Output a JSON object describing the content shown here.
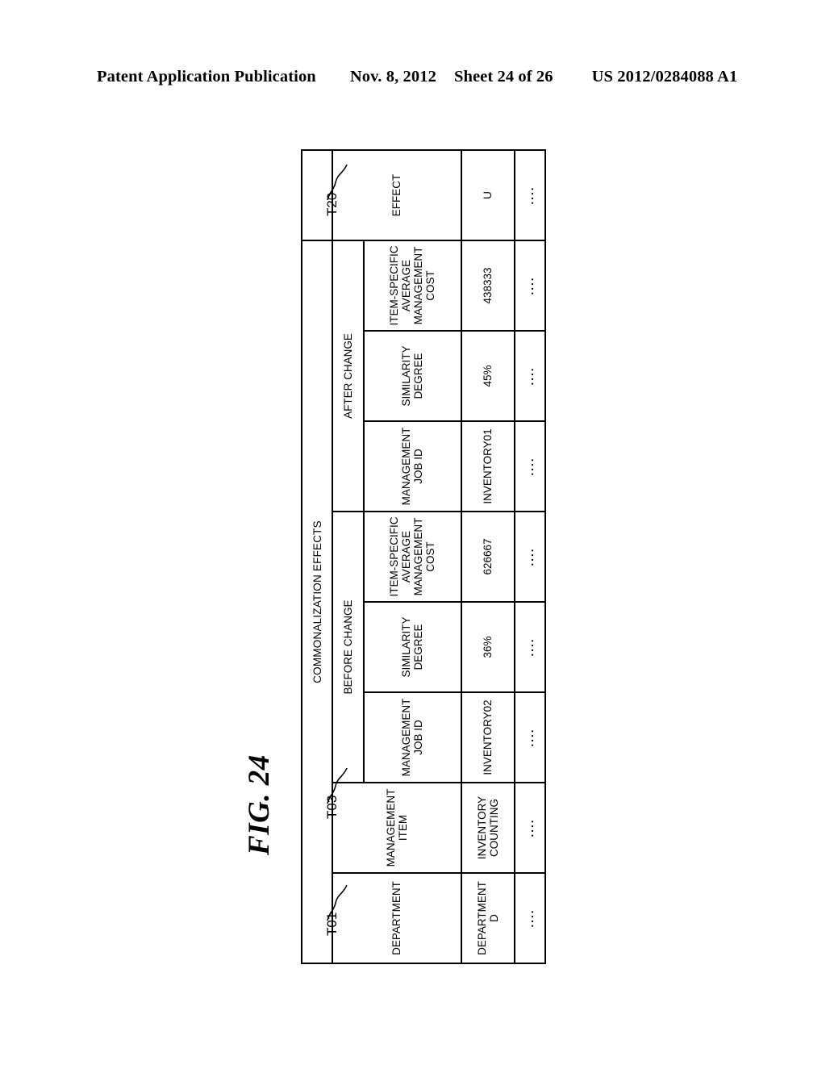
{
  "header": {
    "publication": "Patent Application Publication",
    "date": "Nov. 8, 2012",
    "sheet": "Sheet 24 of 26",
    "number": "US 2012/0284088 A1"
  },
  "figure": {
    "label": "FIG. 24",
    "title": "COMMONALIZATION EFFECTS",
    "markers": [
      {
        "id": "T01",
        "label": "T01"
      },
      {
        "id": "T03",
        "label": "T03"
      },
      {
        "id": "T20",
        "label": "T20"
      }
    ]
  },
  "table": {
    "group_headers": {
      "department": "DEPARTMENT",
      "management_item": "MANAGEMENT\nITEM",
      "before_change": "BEFORE CHANGE",
      "after_change": "AFTER CHANGE",
      "effect": "EFFECT"
    },
    "sub_headers": {
      "before": {
        "job_id": "MANAGEMENT\nJOB ID",
        "similarity": "SIMILARITY\nDEGREE",
        "cost": "ITEM-SPECIFIC\nAVERAGE\nMANAGEMENT\nCOST"
      },
      "after": {
        "job_id": "MANAGEMENT\nJOB ID",
        "similarity": "SIMILARITY\nDEGREE",
        "cost": "ITEM-SPECIFIC\nAVERAGE\nMANAGEMENT\nCOST"
      }
    },
    "rows": [
      {
        "department": "DEPARTMENT D",
        "management_item": "INVENTORY\nCOUNTING",
        "before_job_id": "INVENTORY02",
        "before_similarity": "36%",
        "before_cost": "626667",
        "after_job_id": "INVENTORY01",
        "after_similarity": "45%",
        "after_cost": "438333",
        "effect": "U"
      },
      {
        "department": "....",
        "management_item": "....",
        "before_job_id": "....",
        "before_similarity": "....",
        "before_cost": "....",
        "after_job_id": "....",
        "after_similarity": "....",
        "after_cost": "....",
        "effect": "...."
      }
    ]
  }
}
